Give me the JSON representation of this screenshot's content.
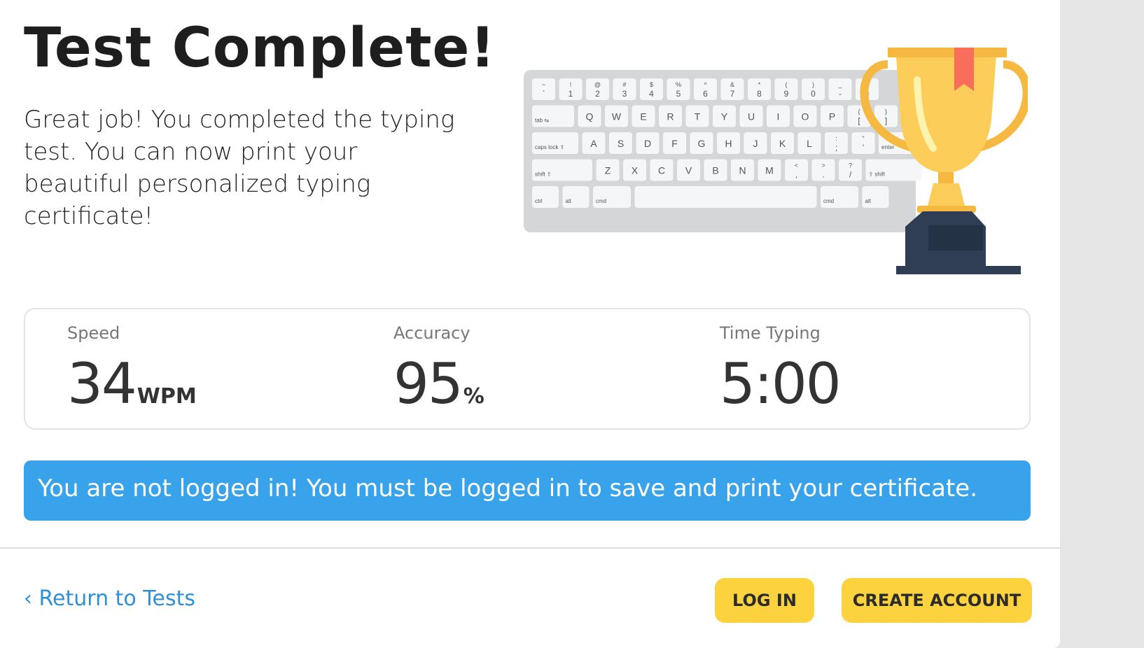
{
  "header": {
    "title": "Test Complete!",
    "subtitle": "Great job! You completed the typing test. You can now print your beautiful personalized typing certificate!"
  },
  "illustration": {
    "icons": [
      "keyboard-icon",
      "trophy-icon"
    ],
    "keyboard_rows": [
      [
        [
          "~",
          "`"
        ],
        [
          "!",
          "1"
        ],
        [
          "@",
          "2"
        ],
        [
          "#",
          "3"
        ],
        [
          "$",
          "4"
        ],
        [
          "%",
          "5"
        ],
        [
          "^",
          "6"
        ],
        [
          "&",
          "7"
        ],
        [
          "*",
          "8"
        ],
        [
          "(",
          "9"
        ],
        [
          ")",
          "0"
        ],
        [
          "_",
          "-"
        ],
        [
          "+",
          "="
        ]
      ],
      [
        [
          "",
          "tab ⇆"
        ],
        [
          "",
          "Q"
        ],
        [
          "",
          "W"
        ],
        [
          "",
          "E"
        ],
        [
          "",
          "R"
        ],
        [
          "",
          "T"
        ],
        [
          "",
          "Y"
        ],
        [
          "",
          "U"
        ],
        [
          "",
          "I"
        ],
        [
          "",
          "O"
        ],
        [
          "",
          "P"
        ],
        [
          "{",
          "["
        ],
        [
          "}",
          "]"
        ]
      ],
      [
        [
          "",
          "caps lock ⇪"
        ],
        [
          "",
          "A"
        ],
        [
          "",
          "S"
        ],
        [
          "",
          "D"
        ],
        [
          "",
          "F"
        ],
        [
          "",
          "G"
        ],
        [
          "",
          "H"
        ],
        [
          "",
          "J"
        ],
        [
          "",
          "K"
        ],
        [
          "",
          "L"
        ],
        [
          ":",
          ";"
        ],
        [
          "\"",
          "'"
        ],
        [
          "",
          "enter"
        ]
      ],
      [
        [
          "",
          "shift ⇧"
        ],
        [
          "",
          "Z"
        ],
        [
          "",
          "X"
        ],
        [
          "",
          "C"
        ],
        [
          "",
          "V"
        ],
        [
          "",
          "B"
        ],
        [
          "",
          "N"
        ],
        [
          "",
          "M"
        ],
        [
          "<",
          ","
        ],
        [
          ">",
          "."
        ],
        [
          "?",
          "/"
        ],
        [
          "",
          "⇧ shift"
        ]
      ],
      [
        [
          "",
          "ctrl"
        ],
        [
          "",
          "alt"
        ],
        [
          "",
          "cmd"
        ],
        [
          "",
          ""
        ],
        [
          "",
          "cmd"
        ],
        [
          "",
          "alt"
        ]
      ]
    ],
    "colors": {
      "keyboard_body": "#d5d6d8",
      "key": "#f5f6f7",
      "trophy_gold": "#fdcd5a",
      "trophy_dark": "#f5b942",
      "ribbon": "#f96e5a",
      "base": "#2f3e55"
    }
  },
  "stats": [
    {
      "label": "Speed",
      "value": "34",
      "unit": "WPM"
    },
    {
      "label": "Accuracy",
      "value": "95",
      "unit": "%"
    },
    {
      "label": "Time Typing",
      "value": "5:00",
      "unit": ""
    }
  ],
  "alert": {
    "text": "You are not logged in! You must be logged in to save and print your certificate.",
    "color": "#38a2ea"
  },
  "footer": {
    "back_link": "‹ Return to Tests",
    "login_button": "LOG IN",
    "create_account_button": "CREATE ACCOUNT",
    "button_color": "#fcd33f"
  }
}
